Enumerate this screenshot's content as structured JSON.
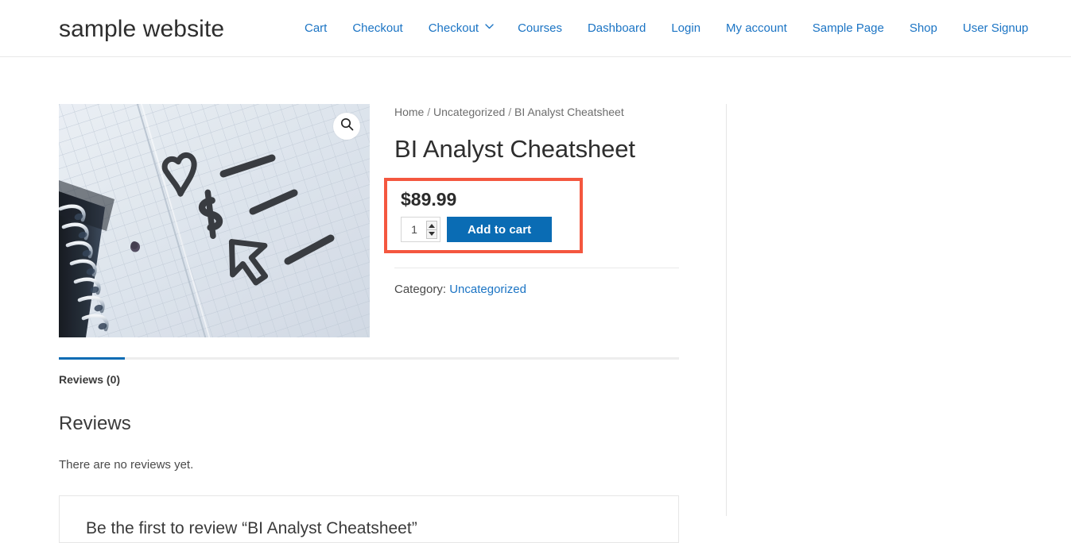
{
  "header": {
    "site_title": "sample website",
    "nav": [
      {
        "label": "Cart",
        "has_dropdown": false
      },
      {
        "label": "Checkout",
        "has_dropdown": false
      },
      {
        "label": "Checkout",
        "has_dropdown": true
      },
      {
        "label": "Courses",
        "has_dropdown": false
      },
      {
        "label": "Dashboard",
        "has_dropdown": false
      },
      {
        "label": "Login",
        "has_dropdown": false
      },
      {
        "label": "My account",
        "has_dropdown": false
      },
      {
        "label": "Sample Page",
        "has_dropdown": false
      },
      {
        "label": "Shop",
        "has_dropdown": false
      },
      {
        "label": "User Signup",
        "has_dropdown": false
      }
    ]
  },
  "gallery": {
    "zoom_icon": "search-icon",
    "image_alt": "spiral notebook graph paper with hand drawn heart, dollar sign and arrow symbols"
  },
  "breadcrumb": {
    "home": "Home",
    "sep1": "/",
    "category": "Uncategorized",
    "sep2": "/",
    "current": "BI Analyst Cheatsheet"
  },
  "product": {
    "title": "BI Analyst Cheatsheet",
    "price": "$89.99",
    "quantity_value": "1",
    "add_to_cart_label": "Add to cart",
    "meta_label": "Category:",
    "meta_category": "Uncategorized"
  },
  "tabs": {
    "active": "Reviews (0)",
    "items": [
      {
        "label": "Reviews (0)"
      }
    ]
  },
  "reviews": {
    "heading": "Reviews",
    "empty_text": "There are no reviews yet.",
    "form_title": "Be the first to review “BI Analyst Cheatsheet”"
  },
  "colors": {
    "link_blue": "#1b74c4",
    "button_blue": "#0a6cb4",
    "highlight_red": "#f4573f",
    "text_dark": "#2e2e2e",
    "muted_gray": "#6d6d6d"
  }
}
